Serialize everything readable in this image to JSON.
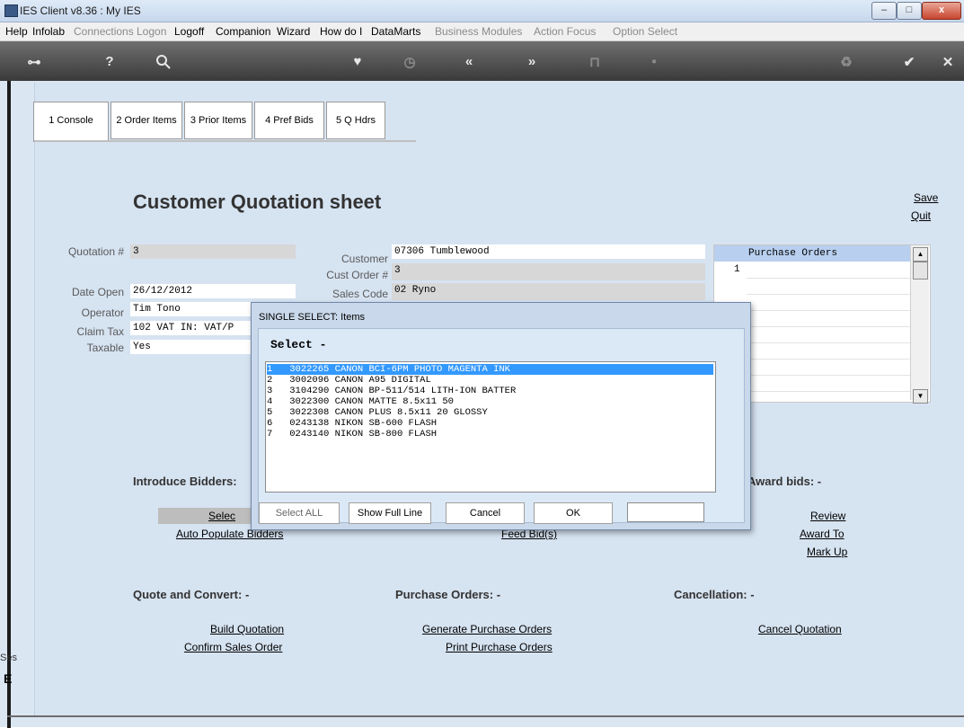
{
  "window": {
    "title": "IES Client v8.36 : My IES",
    "controls": {
      "minimize": "–",
      "maximize": "□",
      "close": "x"
    }
  },
  "menu": {
    "items": [
      {
        "label": "Help",
        "enabled": true
      },
      {
        "label": "Infolab",
        "enabled": true
      },
      {
        "label": "Connections",
        "enabled": false
      },
      {
        "label": "Logon",
        "enabled": false
      },
      {
        "label": "Logoff",
        "enabled": true
      },
      {
        "label": "Companion",
        "enabled": true
      },
      {
        "label": "Wizard",
        "enabled": true
      },
      {
        "label": "How do I",
        "enabled": true
      },
      {
        "label": "DataMarts",
        "enabled": true
      },
      {
        "label": "Business Modules",
        "enabled": false
      },
      {
        "label": "Action Focus",
        "enabled": false
      },
      {
        "label": "Option Select",
        "enabled": false
      }
    ]
  },
  "toolbar": {
    "icons": [
      "key-icon",
      "help-icon",
      "search-icon",
      "heart-icon",
      "clock-icon",
      "rewind-icon",
      "forward-icon",
      "pin-icon",
      "square-icon",
      "recycle-icon",
      "check-icon",
      "close-icon"
    ],
    "glyphs": {
      "key": "⊶",
      "help": "?",
      "search": "🔍",
      "heart": "♥",
      "clock": "◷",
      "rewind": "«",
      "forward": "»",
      "pin": "⊓",
      "square": "▪",
      "recycle": "♻",
      "check": "✔",
      "close": "✕"
    }
  },
  "tabs": [
    {
      "label": "1 Console",
      "active": true
    },
    {
      "label": "2 Order Items",
      "active": false
    },
    {
      "label": "3 Prior Items",
      "active": false
    },
    {
      "label": "4 Pref Bids",
      "active": false
    },
    {
      "label": "5 Q Hdrs",
      "active": false
    }
  ],
  "page": {
    "title": "Customer Quotation sheet",
    "save": "Save",
    "quit": "Quit"
  },
  "form": {
    "quotation_label": "Quotation #",
    "quotation_value": "3",
    "date_open_label": "Date Open",
    "date_open_value": "26/12/2012",
    "operator_label": "Operator",
    "operator_value": "Tim Tono",
    "claim_tax_label": "Claim Tax",
    "claim_tax_value": "102 VAT IN: VAT/P",
    "taxable_label": "Taxable",
    "taxable_value": "Yes",
    "customer_label": "Customer",
    "customer_value": "07306 Tumblewood",
    "cust_order_label": "Cust Order #",
    "cust_order_value": "3",
    "sales_code_label": "Sales Code",
    "sales_code_value": "02 Ryno"
  },
  "purchase_orders": {
    "header": "Purchase Orders",
    "row_numbers": [
      "1"
    ]
  },
  "sections": {
    "introduce_bidders": "Introduce Bidders:",
    "select_bidders": "Selec",
    "auto_populate": "Auto Populate Bidders",
    "feed_bids": "Feed Bid(s)",
    "award_bids": "Award bids: -",
    "review": "Review",
    "award_to": "Award To",
    "mark_up": "Mark Up",
    "quote_convert": "Quote and Convert: -",
    "build_quotation": "Build Quotation",
    "confirm_sales_order": "Confirm Sales Order",
    "purchase_orders": "Purchase Orders: -",
    "generate_po": "Generate Purchase Orders",
    "print_po": "Print Purchase Orders",
    "cancellation": "Cancellation: -",
    "cancel_quotation": "Cancel Quotation"
  },
  "dialog": {
    "title": "SINGLE SELECT: Items",
    "select_label": "Select -",
    "items": [
      {
        "n": "1",
        "code": "3022265",
        "desc": "CANON BCI-6PM PHOTO MAGENTA INK",
        "selected": true
      },
      {
        "n": "2",
        "code": "3002096",
        "desc": "CANON A95 DIGITAL",
        "selected": false
      },
      {
        "n": "3",
        "code": "3104290",
        "desc": "CANON BP-511/514 LITH-ION BATTER",
        "selected": false
      },
      {
        "n": "4",
        "code": "3022300",
        "desc": "CANON MATTE 8.5x11 50",
        "selected": false
      },
      {
        "n": "5",
        "code": "3022308",
        "desc": "CANON PLUS 8.5x11 20 GLOSSY",
        "selected": false
      },
      {
        "n": "6",
        "code": "0243138",
        "desc": "NIKON SB-600 FLASH",
        "selected": false
      },
      {
        "n": "7",
        "code": "0243140",
        "desc": "NIKON SB-800 FLASH",
        "selected": false
      }
    ],
    "buttons": {
      "select_all": "Select ALL",
      "show_full_line": "Show Full Line",
      "cancel": "Cancel",
      "ok": "OK"
    },
    "search_value": ""
  },
  "footer": {
    "ses": "Ses",
    "status_glyph": "E"
  }
}
